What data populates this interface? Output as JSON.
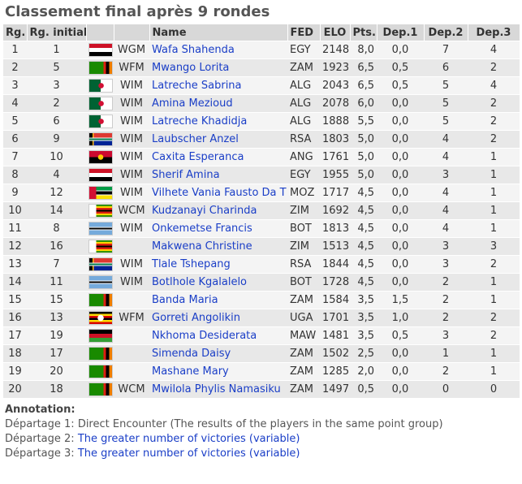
{
  "page": {
    "title": "Classement final après 9 rondes"
  },
  "table": {
    "headers": {
      "rank": "Rg.",
      "initial": "Rg. initial",
      "name": "Name",
      "fed": "FED",
      "elo": "ELO",
      "pts": "Pts.",
      "dep1": "Dep.1",
      "dep2": "Dep.2",
      "dep3": "Dep.3"
    },
    "rows": [
      {
        "rank": "1",
        "init": "1",
        "flag": "egy",
        "title": "WGM",
        "name": "Wafa Shahenda",
        "fed": "EGY",
        "elo": "2148",
        "pts": "8,0",
        "d1": "0,0",
        "d2": "7",
        "d3": "4"
      },
      {
        "rank": "2",
        "init": "5",
        "flag": "zam",
        "title": "WFM",
        "name": "Mwango Lorita",
        "fed": "ZAM",
        "elo": "1923",
        "pts": "6,5",
        "d1": "0,5",
        "d2": "6",
        "d3": "2"
      },
      {
        "rank": "3",
        "init": "3",
        "flag": "alg",
        "title": "WIM",
        "name": "Latreche Sabrina",
        "fed": "ALG",
        "elo": "2043",
        "pts": "6,5",
        "d1": "0,5",
        "d2": "5",
        "d3": "4"
      },
      {
        "rank": "4",
        "init": "2",
        "flag": "alg",
        "title": "WIM",
        "name": "Amina Mezioud",
        "fed": "ALG",
        "elo": "2078",
        "pts": "6,0",
        "d1": "0,0",
        "d2": "5",
        "d3": "2"
      },
      {
        "rank": "5",
        "init": "6",
        "flag": "alg",
        "title": "WIM",
        "name": "Latreche Khadidja",
        "fed": "ALG",
        "elo": "1888",
        "pts": "5,5",
        "d1": "0,0",
        "d2": "5",
        "d3": "2"
      },
      {
        "rank": "6",
        "init": "9",
        "flag": "rsa",
        "title": "WIM",
        "name": "Laubscher Anzel",
        "fed": "RSA",
        "elo": "1803",
        "pts": "5,0",
        "d1": "0,0",
        "d2": "4",
        "d3": "2"
      },
      {
        "rank": "7",
        "init": "10",
        "flag": "ang",
        "title": "WIM",
        "name": "Caxita Esperanca",
        "fed": "ANG",
        "elo": "1761",
        "pts": "5,0",
        "d1": "0,0",
        "d2": "4",
        "d3": "1"
      },
      {
        "rank": "8",
        "init": "4",
        "flag": "egy",
        "title": "WIM",
        "name": "Sherif Amina",
        "fed": "EGY",
        "elo": "1955",
        "pts": "5,0",
        "d1": "0,0",
        "d2": "3",
        "d3": "1"
      },
      {
        "rank": "9",
        "init": "12",
        "flag": "moz",
        "title": "WIM",
        "name": "Vilhete Vania Fausto Da T",
        "fed": "MOZ",
        "elo": "1717",
        "pts": "4,5",
        "d1": "0,0",
        "d2": "4",
        "d3": "1"
      },
      {
        "rank": "10",
        "init": "14",
        "flag": "zim",
        "title": "WCM",
        "name": "Kudzanayi Charinda",
        "fed": "ZIM",
        "elo": "1692",
        "pts": "4,5",
        "d1": "0,0",
        "d2": "4",
        "d3": "1"
      },
      {
        "rank": "11",
        "init": "8",
        "flag": "bot",
        "title": "WIM",
        "name": "Onkemetse Francis",
        "fed": "BOT",
        "elo": "1813",
        "pts": "4,5",
        "d1": "0,0",
        "d2": "4",
        "d3": "1"
      },
      {
        "rank": "12",
        "init": "16",
        "flag": "zim",
        "title": "",
        "name": "Makwena Christine",
        "fed": "ZIM",
        "elo": "1513",
        "pts": "4,5",
        "d1": "0,0",
        "d2": "3",
        "d3": "3"
      },
      {
        "rank": "13",
        "init": "7",
        "flag": "rsa",
        "title": "WIM",
        "name": "Tlale Tshepang",
        "fed": "RSA",
        "elo": "1844",
        "pts": "4,5",
        "d1": "0,0",
        "d2": "3",
        "d3": "2"
      },
      {
        "rank": "14",
        "init": "11",
        "flag": "bot",
        "title": "WIM",
        "name": "Botlhole Kgalalelo",
        "fed": "BOT",
        "elo": "1728",
        "pts": "4,5",
        "d1": "0,0",
        "d2": "2",
        "d3": "1"
      },
      {
        "rank": "15",
        "init": "15",
        "flag": "zam",
        "title": "",
        "name": "Banda Maria",
        "fed": "ZAM",
        "elo": "1584",
        "pts": "3,5",
        "d1": "1,5",
        "d2": "2",
        "d3": "1"
      },
      {
        "rank": "16",
        "init": "13",
        "flag": "uga",
        "title": "WFM",
        "name": "Gorreti Angolikin",
        "fed": "UGA",
        "elo": "1701",
        "pts": "3,5",
        "d1": "1,0",
        "d2": "2",
        "d3": "2"
      },
      {
        "rank": "17",
        "init": "19",
        "flag": "maw",
        "title": "",
        "name": "Nkhoma Desiderata",
        "fed": "MAW",
        "elo": "1481",
        "pts": "3,5",
        "d1": "0,5",
        "d2": "3",
        "d3": "2"
      },
      {
        "rank": "18",
        "init": "17",
        "flag": "zam",
        "title": "",
        "name": "Simenda Daisy",
        "fed": "ZAM",
        "elo": "1502",
        "pts": "2,5",
        "d1": "0,0",
        "d2": "1",
        "d3": "1"
      },
      {
        "rank": "19",
        "init": "20",
        "flag": "zam",
        "title": "",
        "name": "Mashane Mary",
        "fed": "ZAM",
        "elo": "1285",
        "pts": "2,0",
        "d1": "0,0",
        "d2": "2",
        "d3": "1"
      },
      {
        "rank": "20",
        "init": "18",
        "flag": "zam",
        "title": "WCM",
        "name": "Mwilola Phylis Namasiku",
        "fed": "ZAM",
        "elo": "1497",
        "pts": "0,5",
        "d1": "0,0",
        "d2": "0",
        "d3": "0"
      }
    ]
  },
  "annotation": {
    "heading": "Annotation:",
    "lines": [
      {
        "label": "Départage 1: ",
        "text": "Direct Encounter (The results of the players in the same point group)",
        "link": false
      },
      {
        "label": "Départage 2: ",
        "text": "The greater number of victories (variable)",
        "link": true
      },
      {
        "label": "Départage 3: ",
        "text": "The greater number of victories (variable)",
        "link": true
      }
    ]
  },
  "flags": {
    "egy": "linear-gradient(#ce1126 0 33%, #ffffff 33% 66%, #000000 66%)",
    "zam": "linear-gradient(90deg, #198a00 0 62%, #de2010 62% 74%, #000000 74% 87%, #ef7d00 87%)",
    "alg": "radial-gradient(circle at 52% 50%, #d21034 0 3px, transparent 3.5px), linear-gradient(90deg, #006233 0 50%, #ffffff 50%)",
    "rsa": "linear-gradient(180deg, transparent 0 38%, #ffffff 38% 44%, #007a4d 44% 56%, #ffffff 56% 62%, transparent 62%), linear-gradient(90deg, #000000 0 14%, #ffb612 14% 20%, transparent 20%), linear-gradient(#de3831 0 50%, #002395 50%)",
    "ang": "radial-gradient(circle at 50% 50%, #ffcb00 0 3px, transparent 3.5px), linear-gradient(#cc092f 0 50%, #000000 50%)",
    "moz": "linear-gradient(90deg, #d21034 0 30%, transparent 30%), linear-gradient(#009a44 0 30%, #ffffff 30% 36%, #000000 36% 64%, #ffffff 64% 70%, #fce100 70%)",
    "zim": "linear-gradient(90deg, #ffffff 0 30%, transparent 30%), linear-gradient(#319208 0 14%, #ffd200 14% 28%, #de2010 28% 42%, #000000 42% 58%, #de2010 58% 72%, #ffd200 72% 86%, #319208 86%)",
    "bot": "linear-gradient(#75aadb 0 38%, #ffffff 38% 44%, #000000 44% 56%, #ffffff 56% 62%, #75aadb 62%)",
    "uga": "radial-gradient(circle at 50% 50%, #ffffff 0 3.5px, transparent 4px), linear-gradient(#000000 0 16.6%, #fcdc04 16.6% 33.3%, #d90000 33.3% 50%, #000000 50% 66.6%, #fcdc04 66.6% 83.3%, #d90000 83.3%)",
    "maw": "linear-gradient(#000000 0 33%, #ce1126 33% 66%, #339e35 66%)"
  }
}
